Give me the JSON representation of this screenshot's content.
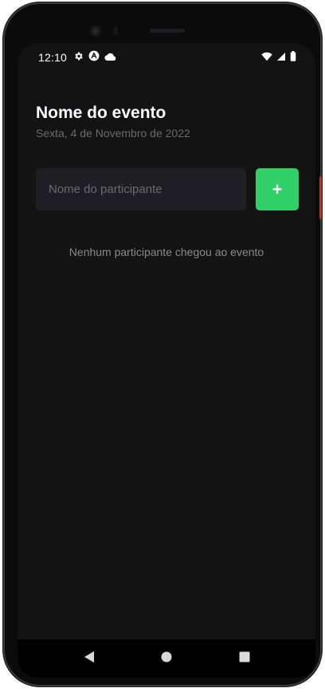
{
  "status_bar": {
    "time": "12:10",
    "left_icons": [
      "gear-icon",
      "app-a-icon",
      "cloud-icon"
    ],
    "right_icons": [
      "wifi-icon",
      "cell-signal-icon",
      "battery-icon"
    ]
  },
  "event": {
    "title": "Nome do evento",
    "date": "Sexta, 4 de Novembro de 2022"
  },
  "form": {
    "input_value": "",
    "input_placeholder": "Nome do participante",
    "add_button_label": "+"
  },
  "list": {
    "empty_message": "Nenhum participante chegou ao evento"
  },
  "nav_bar": {
    "buttons": [
      "back-icon",
      "home-icon",
      "recents-icon"
    ]
  },
  "colors": {
    "background": "#131314",
    "input_background": "#1f1e25",
    "accent": "#31cf67",
    "title": "#fdfcfe",
    "muted_text": "#6b6b6b"
  }
}
